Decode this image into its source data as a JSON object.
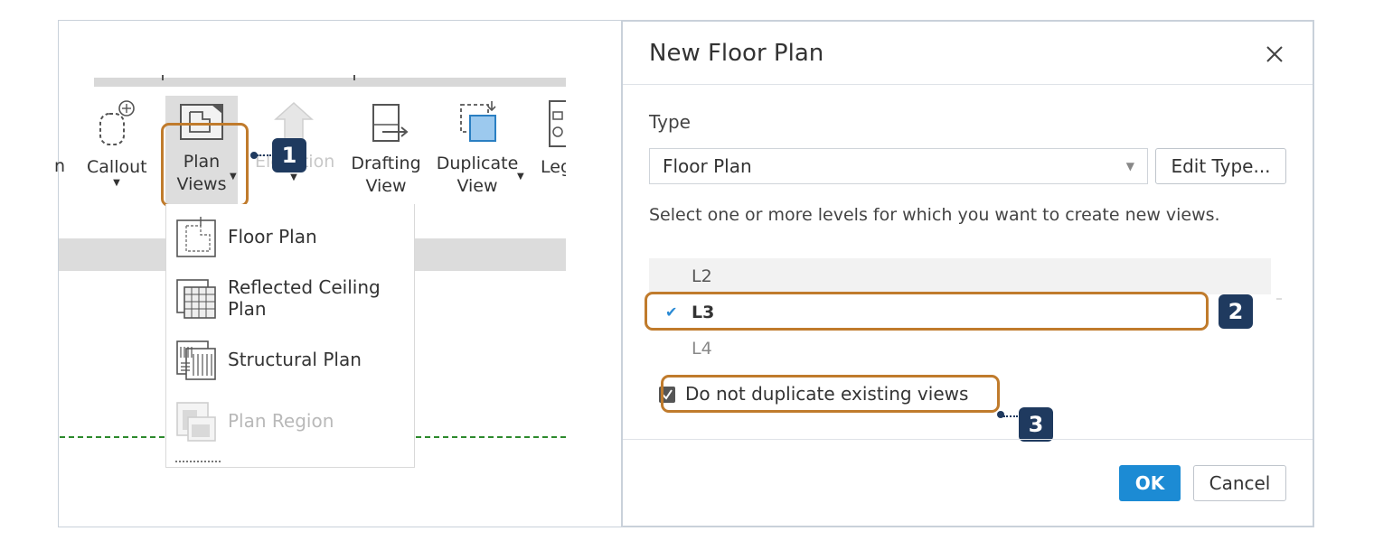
{
  "ribbon": {
    "tools": [
      {
        "id": "section",
        "label": "n"
      },
      {
        "id": "callout",
        "label": "Callout"
      },
      {
        "id": "plan-views",
        "label_line1": "Plan",
        "label_line2": "Views"
      },
      {
        "id": "elevation",
        "label": "Elevation"
      },
      {
        "id": "drafting-view",
        "label_line1": "Drafting",
        "label_line2": "View"
      },
      {
        "id": "duplicate-view",
        "label_line1": "Duplicate",
        "label_line2": "View"
      },
      {
        "id": "legends",
        "label": "Leg"
      }
    ],
    "dropdown": [
      {
        "label": "Floor Plan",
        "enabled": true
      },
      {
        "label": "Reflected Ceiling Plan",
        "enabled": true
      },
      {
        "label": "Structural Plan",
        "enabled": true
      },
      {
        "label": "Plan Region",
        "enabled": false
      }
    ]
  },
  "annotations": {
    "badge1": "1",
    "badge2": "2",
    "badge3": "3"
  },
  "dialog": {
    "title": "New Floor Plan",
    "type_label": "Type",
    "type_value": "Floor Plan",
    "edit_type_label": "Edit Type...",
    "instructions": "Select one or more levels for which you want to create new views.",
    "levels": [
      {
        "label": "L2",
        "checked": false
      },
      {
        "label": "L3",
        "checked": true
      },
      {
        "label": "L4",
        "checked": false
      }
    ],
    "dont_duplicate_label": "Do not duplicate existing views",
    "dont_duplicate_checked": true,
    "ok_label": "OK",
    "cancel_label": "Cancel"
  },
  "colors": {
    "accent": "#1c8bd4",
    "highlight": "#c07b2c",
    "badge": "#1f3a5f"
  }
}
